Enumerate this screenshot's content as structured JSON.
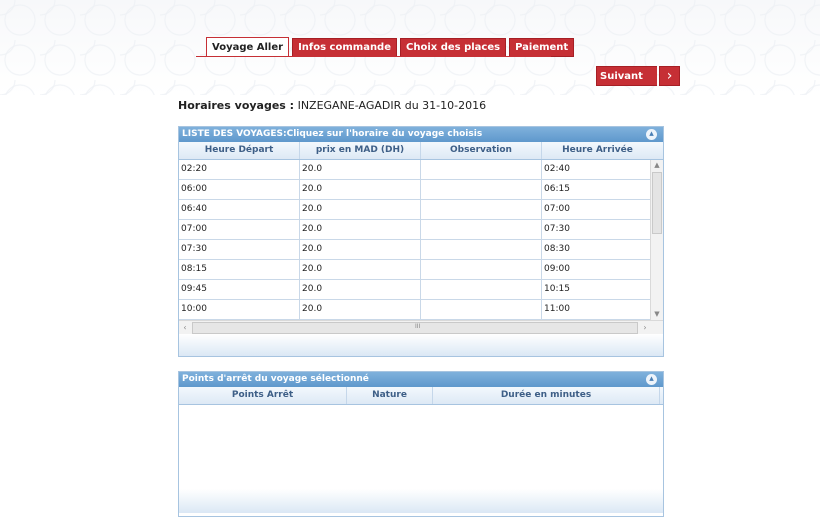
{
  "tabs": [
    {
      "label": "Voyage Aller"
    },
    {
      "label": "Infos commande"
    },
    {
      "label": "Choix des places"
    },
    {
      "label": "Paiement"
    }
  ],
  "suivant_label": "Suivant",
  "schedule": {
    "label": "Horaires voyages :",
    "route": " INZEGANE-AGADIR du 31-10-2016"
  },
  "trips_panel": {
    "title": "LISTE DES VOYAGES:Cliquez sur l'horaire du voyage choisis",
    "columns": [
      "Heure Départ",
      "prix en MAD (DH)",
      "Observation",
      "Heure Arrivée"
    ],
    "rows": [
      [
        "02:20",
        "20.0",
        "",
        "02:40"
      ],
      [
        "06:00",
        "20.0",
        "",
        "06:15"
      ],
      [
        "06:40",
        "20.0",
        "",
        "07:00"
      ],
      [
        "07:00",
        "20.0",
        "",
        "07:30"
      ],
      [
        "07:30",
        "20.0",
        "",
        "08:30"
      ],
      [
        "08:15",
        "20.0",
        "",
        "09:00"
      ],
      [
        "09:45",
        "20.0",
        "",
        "10:15"
      ],
      [
        "10:00",
        "20.0",
        "",
        "11:00"
      ]
    ]
  },
  "stops_panel": {
    "title": "Points d'arrêt du voyage sélectionné",
    "columns": [
      "Points Arrêt",
      "Nature",
      "Durée en minutes"
    ]
  },
  "colors": {
    "accent": "#c62f35",
    "panel_header": "#6aa3d5"
  }
}
